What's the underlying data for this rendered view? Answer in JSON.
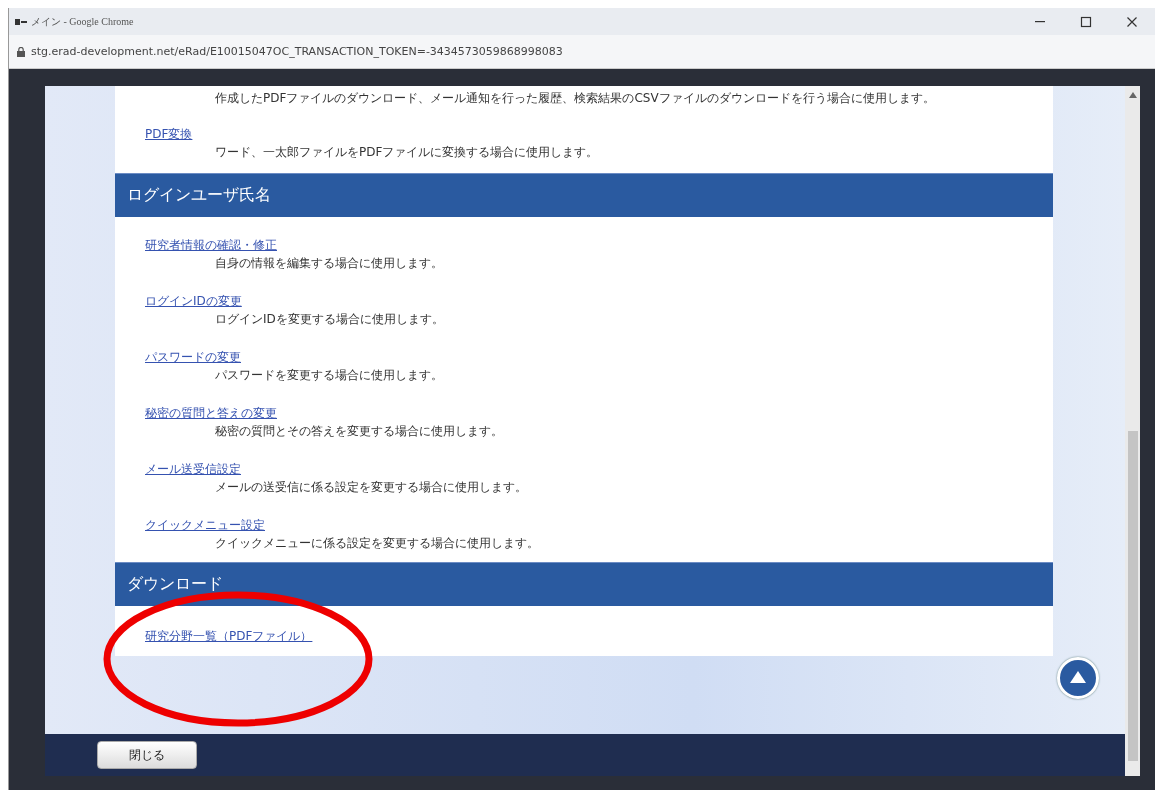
{
  "window": {
    "title": "メイン - Google Chrome",
    "url": "stg.erad-development.net/eRad/E10015047OC_TRANSACTION_TOKEN=-3434573059868998083"
  },
  "top_items": [
    {
      "description": "作成したPDFファイルのダウンロード、メール通知を行った履歴、検索結果のCSVファイルのダウンロードを行う場合に使用します。"
    },
    {
      "link": "PDF変換",
      "description": "ワード、一太郎ファイルをPDFファイルに変換する場合に使用します。"
    }
  ],
  "sections": [
    {
      "heading": "ログインユーザ氏名",
      "items": [
        {
          "link": "研究者情報の確認・修正",
          "description": "自身の情報を編集する場合に使用します。"
        },
        {
          "link": "ログインIDの変更",
          "description": "ログインIDを変更する場合に使用します。"
        },
        {
          "link": "パスワードの変更",
          "description": "パスワードを変更する場合に使用します。"
        },
        {
          "link": "秘密の質問と答えの変更",
          "description": "秘密の質問とその答えを変更する場合に使用します。"
        },
        {
          "link": "メール送受信設定",
          "description": "メールの送受信に係る設定を変更する場合に使用します。"
        },
        {
          "link": "クイックメニュー設定",
          "description": "クイックメニューに係る設定を変更する場合に使用します。"
        }
      ]
    },
    {
      "heading": "ダウンロード",
      "items": [
        {
          "link": "研究分野一覧（PDFファイル）"
        }
      ]
    }
  ],
  "footer": {
    "close_button": "閉じる"
  },
  "annotations": [
    {
      "kind": "ellipse"
    }
  ]
}
